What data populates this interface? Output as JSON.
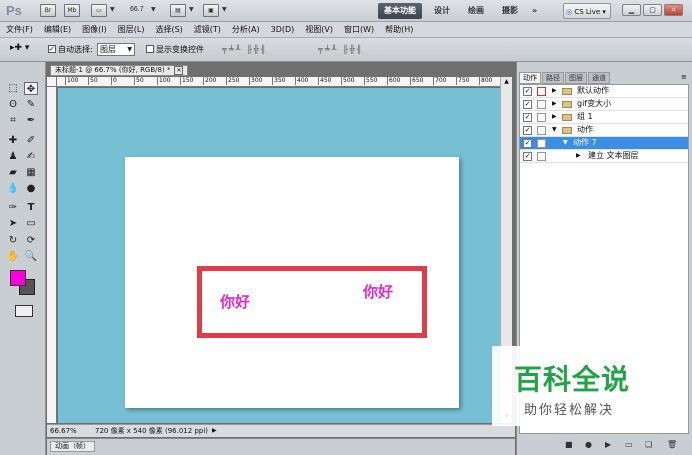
{
  "app": {
    "logo": "Ps",
    "zoom_display": "66.7"
  },
  "workspace": {
    "buttons": [
      "基本功能",
      "设计",
      "绘画",
      "摄影",
      "»"
    ],
    "active_index": 0
  },
  "cslive": "CS Live",
  "menu": [
    "文件(F)",
    "编辑(E)",
    "图像(I)",
    "图层(L)",
    "选择(S)",
    "滤镜(T)",
    "分析(A)",
    "3D(D)",
    "视图(V)",
    "窗口(W)",
    "帮助(H)"
  ],
  "options": {
    "auto_select_label": "自动选择:",
    "auto_select_value": "图层",
    "show_transform_label": "显示变换控件"
  },
  "document": {
    "tab_title": "未标题-1 @ 66.7% (你好, RGB/8) *",
    "ruler_marks": [
      "100",
      "50",
      "0",
      "50",
      "100",
      "150",
      "200",
      "250",
      "300",
      "350",
      "400",
      "450",
      "500",
      "550",
      "600",
      "650",
      "700",
      "750",
      "800"
    ],
    "text1": "你好",
    "text2": "你好"
  },
  "status": {
    "zoom": "66.67%",
    "info": "720 像素 x 540 像素 (96.012 ppi)"
  },
  "animation_tab": "动画（帧）",
  "panel": {
    "tabs": [
      "动作",
      "路径",
      "图层",
      "通道"
    ],
    "active_tab": 0,
    "actions": [
      {
        "label": "默认动作",
        "indent": 0,
        "expanded": false,
        "folder": true
      },
      {
        "label": "gif变大小",
        "indent": 0,
        "expanded": false,
        "folder": true
      },
      {
        "label": "组 1",
        "indent": 0,
        "expanded": false,
        "folder": true
      },
      {
        "label": "动作",
        "indent": 0,
        "expanded": true,
        "folder": true
      },
      {
        "label": "动作 7",
        "indent": 1,
        "expanded": true,
        "folder": false,
        "selected": true
      },
      {
        "label": "建立 文本图层",
        "indent": 2,
        "expanded": false,
        "folder": false
      }
    ]
  },
  "watermark": {
    "title": "百科全说",
    "subtitle": "助你轻松解决"
  },
  "colors": {
    "foreground": "#ff00dd",
    "background": "#555555",
    "canvas_bg": "#77bfd3",
    "text": "#e02ac9",
    "frame": "#e23b4a"
  }
}
